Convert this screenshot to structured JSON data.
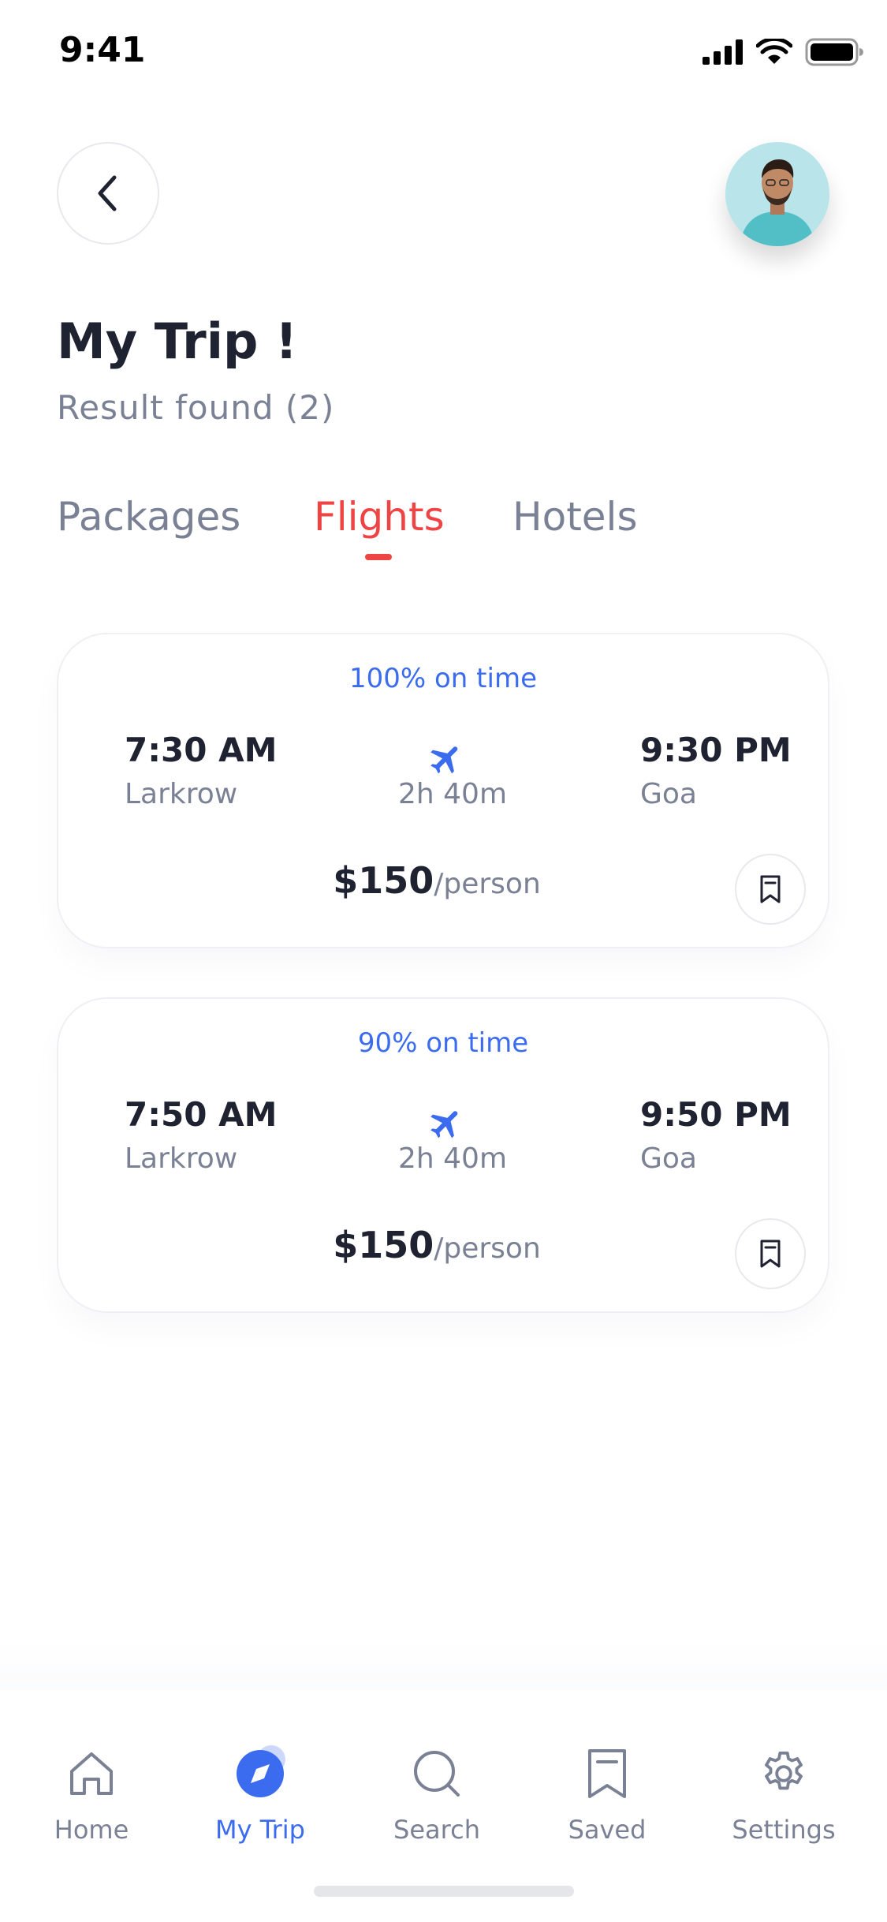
{
  "status_bar": {
    "time": "9:41"
  },
  "header": {
    "title": "My Trip !",
    "result_text": "Result found (2)"
  },
  "tabs": [
    {
      "label": "Packages",
      "active": false
    },
    {
      "label": "Flights",
      "active": true
    },
    {
      "label": "Hotels",
      "active": false
    }
  ],
  "flights": [
    {
      "on_time": "100% on time",
      "departure_time": "7:30 AM",
      "departure_city": "Larkrow",
      "duration": "2h 40m",
      "arrival_time": "9:30 PM",
      "arrival_city": "Goa",
      "price": "$150",
      "price_unit": "/person"
    },
    {
      "on_time": "90% on time",
      "departure_time": "7:50 AM",
      "departure_city": "Larkrow",
      "duration": "2h 40m",
      "arrival_time": "9:50 PM",
      "arrival_city": "Goa",
      "price": "$150",
      "price_unit": "/person"
    }
  ],
  "bottom_nav": [
    {
      "label": "Home",
      "icon": "home-icon",
      "active": false
    },
    {
      "label": "My Trip",
      "icon": "compass-icon",
      "active": true
    },
    {
      "label": "Search",
      "icon": "search-icon",
      "active": false
    },
    {
      "label": "Saved",
      "icon": "bookmark-icon",
      "active": false
    },
    {
      "label": "Settings",
      "icon": "gear-icon",
      "active": false
    }
  ],
  "colors": {
    "accent_red": "#ef4444",
    "accent_blue": "#3b6cf0",
    "text_dark": "#1f2230",
    "text_muted": "#7b8195"
  }
}
